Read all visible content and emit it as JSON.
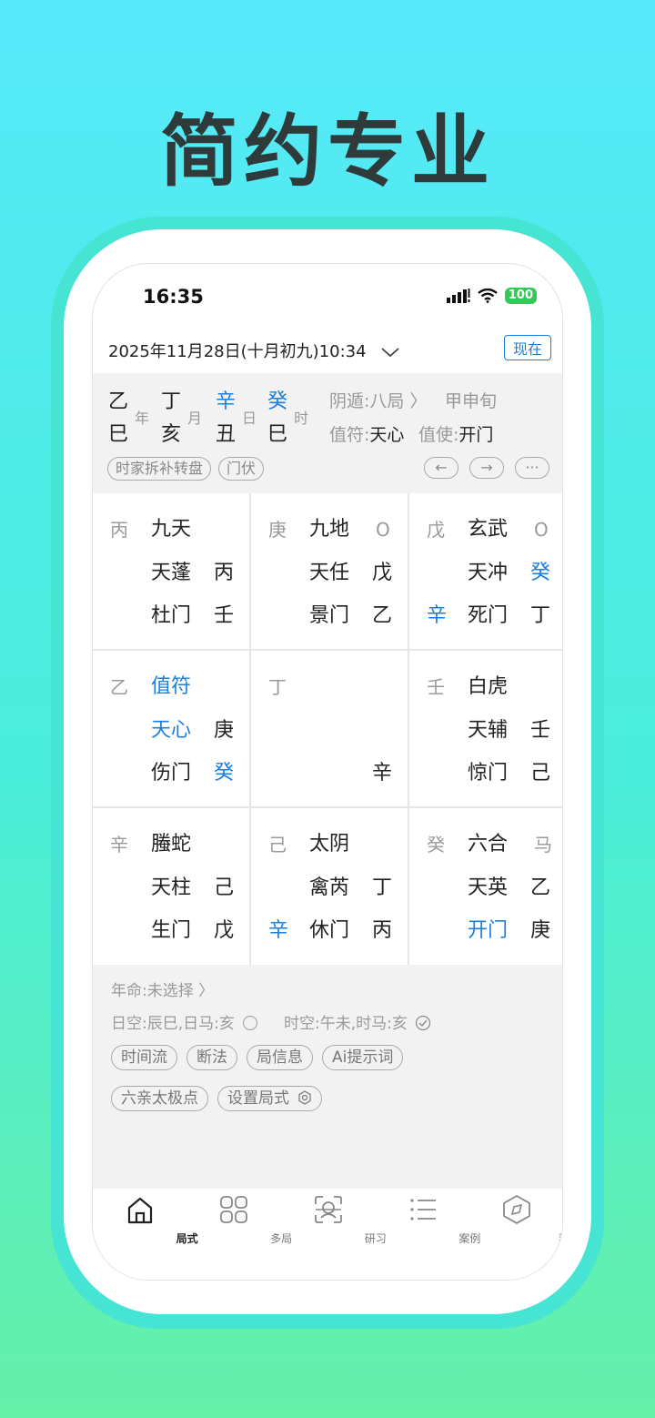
{
  "promo": {
    "headline": "简约专业"
  },
  "status": {
    "time": "16:35",
    "battery": "100"
  },
  "date": {
    "text": "2025年11月28日(十月初九)10:34",
    "now_button": "现在"
  },
  "pillars": [
    {
      "top": "乙",
      "bottom": "巳",
      "label": "年",
      "top_color": "black"
    },
    {
      "top": "丁",
      "bottom": "亥",
      "label": "月",
      "top_color": "black"
    },
    {
      "top": "辛",
      "bottom": "丑",
      "label": "日",
      "top_color": "blue"
    },
    {
      "top": "癸",
      "bottom": "巳",
      "label": "时",
      "top_color": "blue"
    }
  ],
  "ju": {
    "dun": "阴遁:八局",
    "xun": "甲申旬",
    "zhifu_label": "值符:",
    "zhifu_value": "天心",
    "zhishi_label": "值使:",
    "zhishi_value": "开门"
  },
  "tags": [
    "时家拆补转盘",
    "门伏"
  ],
  "nav": {
    "prev": "←",
    "next": "→",
    "more": "···"
  },
  "palaces": [
    {
      "stem": "丙",
      "god": "九天",
      "star": "天蓬",
      "star_stem": "丙",
      "door": "杜门",
      "door_stem": "壬",
      "mark": "",
      "side": ""
    },
    {
      "stem": "庚",
      "god": "九地",
      "star": "天任",
      "star_stem": "戊",
      "door": "景门",
      "door_stem": "乙",
      "mark": "O",
      "side": ""
    },
    {
      "stem": "戊",
      "god": "玄武",
      "star": "天冲",
      "star_stem": "癸",
      "door": "死门",
      "door_stem": "丁",
      "mark": "O",
      "side": "辛"
    },
    {
      "stem": "乙",
      "god": "值符",
      "star": "天心",
      "star_stem": "庚",
      "door": "伤门",
      "door_stem": "癸",
      "mark": "",
      "side": ""
    },
    {
      "stem": "丁",
      "god": "",
      "star": "",
      "star_stem": "",
      "door": "",
      "door_stem": "辛",
      "mark": "",
      "side": ""
    },
    {
      "stem": "壬",
      "god": "白虎",
      "star": "天辅",
      "star_stem": "壬",
      "door": "惊门",
      "door_stem": "己",
      "mark": "",
      "side": ""
    },
    {
      "stem": "辛",
      "god": "螣蛇",
      "star": "天柱",
      "star_stem": "己",
      "door": "生门",
      "door_stem": "戊",
      "mark": "",
      "side": ""
    },
    {
      "stem": "己",
      "god": "太阴",
      "star": "禽芮",
      "star_stem": "丁",
      "door": "休门",
      "door_stem": "丙",
      "mark": "",
      "side": "辛"
    },
    {
      "stem": "癸",
      "god": "六合",
      "star": "天英",
      "star_stem": "乙",
      "door": "开门",
      "door_stem": "庚",
      "mark": "马",
      "side": ""
    }
  ],
  "bottom": {
    "nianming": "年命:未选择 〉",
    "rikong": "日空:辰巳,日马:亥",
    "shikong": "时空:午未,时马:亥",
    "tags_row1": [
      "时间流",
      "断法",
      "局信息",
      "Ai提示词"
    ],
    "tags_row2": [
      "六亲太极点",
      "设置局式"
    ]
  },
  "tabs": [
    {
      "label": "局式",
      "icon": "home-icon",
      "active": true
    },
    {
      "label": "多局",
      "icon": "grid-icon",
      "active": false
    },
    {
      "label": "研习",
      "icon": "scan-icon",
      "active": false
    },
    {
      "label": "案例",
      "icon": "list-icon",
      "active": false
    },
    {
      "label": "我",
      "icon": "compass-icon",
      "active": false
    }
  ],
  "colors": {
    "blue": "#1a7fe0",
    "battery": "#34c759",
    "panel": "#f2f2f2"
  }
}
